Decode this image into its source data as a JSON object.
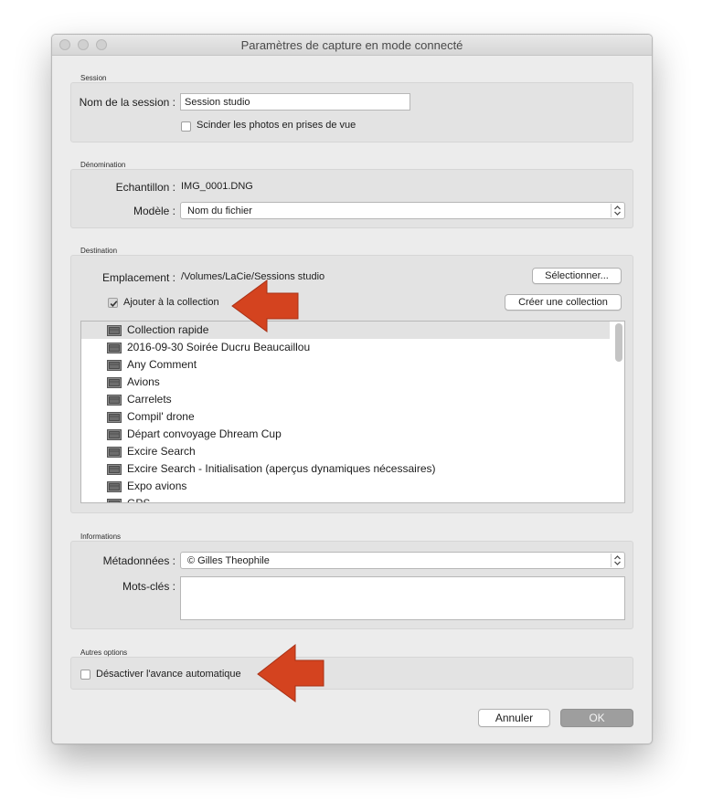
{
  "window": {
    "title": "Paramètres de capture en mode connecté"
  },
  "session": {
    "section": "Session",
    "name_label": "Nom de la session :",
    "name_value": "Session studio",
    "split_label": "Scinder les photos en prises de vue",
    "split_checked": false
  },
  "naming": {
    "section": "Dénomination",
    "sample_label": "Echantillon :",
    "sample_value": "IMG_0001.DNG",
    "template_label": "Modèle :",
    "template_value": "Nom du fichier"
  },
  "destination": {
    "section": "Destination",
    "location_label": "Emplacement :",
    "location_value": "/Volumes/LaCie/Sessions studio",
    "select_button": "Sélectionner...",
    "add_collection_label": "Ajouter à la collection",
    "add_collection_checked": true,
    "create_collection_button": "Créer une collection",
    "collections": [
      "Collection rapide",
      "2016-09-30 Soirée Ducru Beaucaillou",
      "Any Comment",
      "Avions",
      "Carrelets",
      "Compil' drone",
      "Départ convoyage Dhream Cup",
      "Excire Search",
      "Excire Search - Initialisation (aperçus dynamiques nécessaires)",
      "Expo avions",
      "GPS"
    ],
    "selected_collection_index": 0
  },
  "info": {
    "section": "Informations",
    "metadata_label": "Métadonnées :",
    "metadata_value": "© Gilles Theophile",
    "keywords_label": "Mots-clés :",
    "keywords_value": ""
  },
  "other": {
    "section": "Autres options",
    "disable_autoadvance_label": "Désactiver l'avance automatique",
    "disable_autoadvance_checked": false
  },
  "footer": {
    "cancel": "Annuler",
    "ok": "OK"
  },
  "colors": {
    "arrow": "#d4431f",
    "ok_button": "#9e9e9e"
  }
}
